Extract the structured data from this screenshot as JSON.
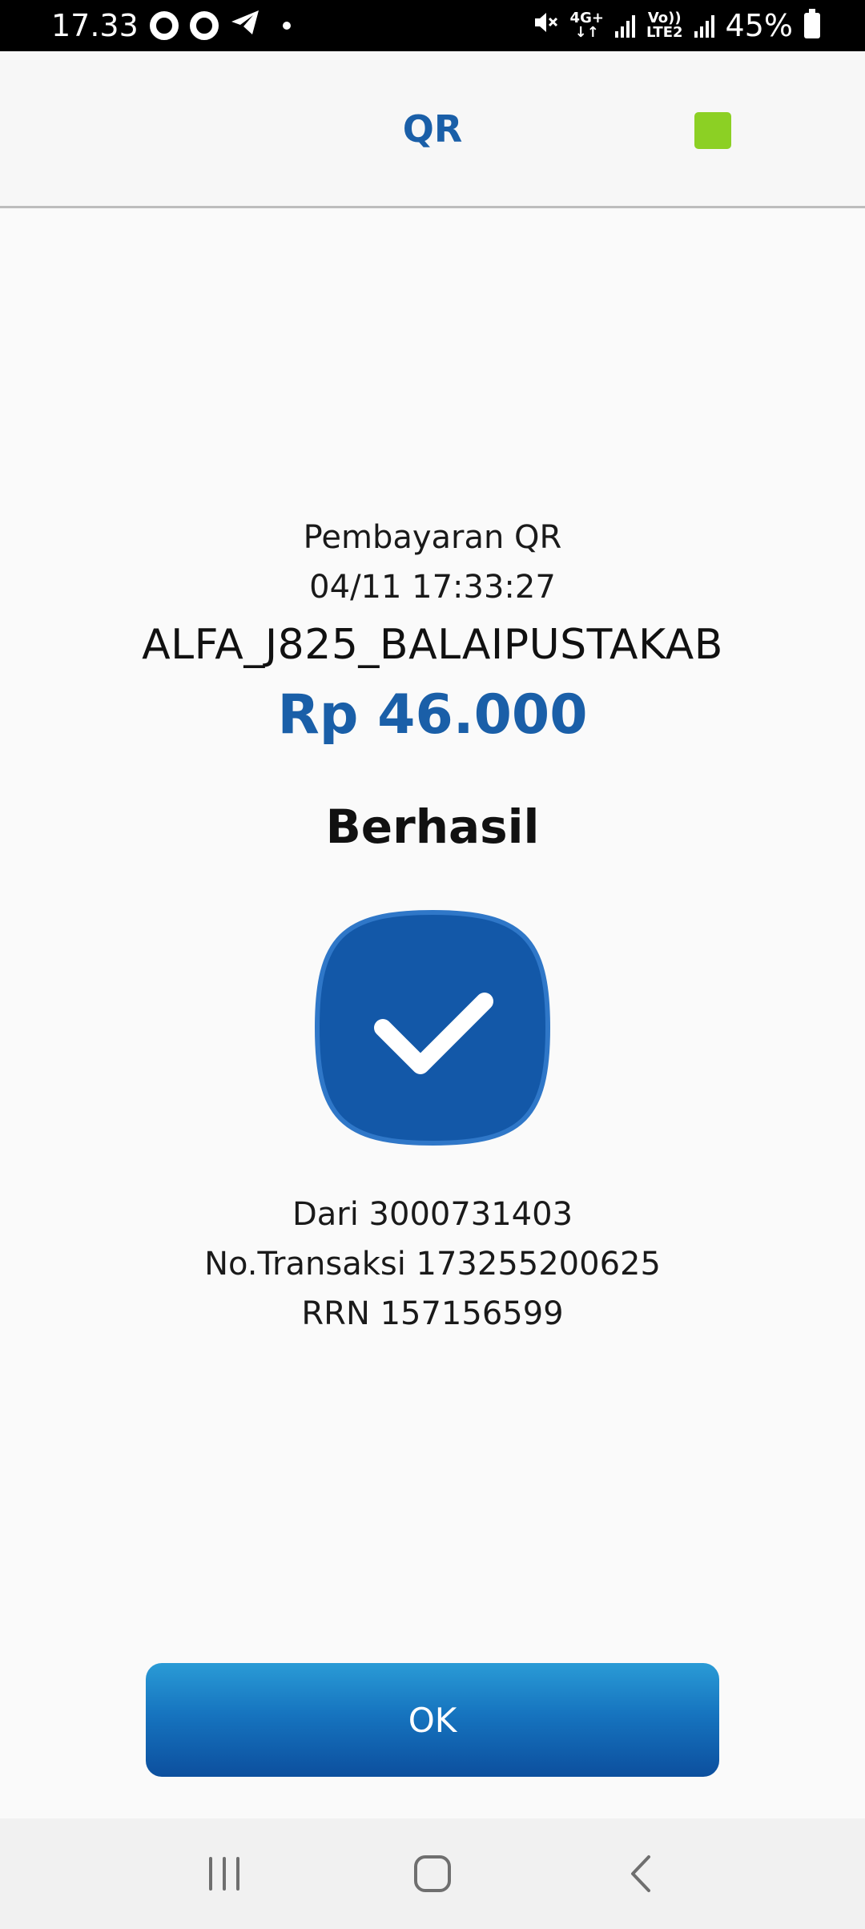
{
  "status_bar": {
    "time": "17.33",
    "network_type": "4G+",
    "volte_label": "Vo))",
    "lte_label": "LTE2",
    "battery": "45%"
  },
  "header": {
    "title": "QR"
  },
  "transaction": {
    "type": "Pembayaran QR",
    "datetime": "04/11 17:33:27",
    "merchant": "ALFA_J825_BALAIPUSTAKAB",
    "amount": "Rp 46.000",
    "status": "Berhasil",
    "from": "Dari 3000731403",
    "transaction_no": "No.Transaksi 173255200625",
    "rrn": "RRN 157156599"
  },
  "actions": {
    "ok_label": "OK"
  },
  "colors": {
    "accent": "#1a5fa8",
    "header_square": "#8cd024",
    "button_top": "#2a9bd6",
    "button_bottom": "#0c4f9e"
  },
  "icons": {
    "status_left": [
      "ring-icon",
      "ring-icon",
      "telegram-icon",
      "dot-icon"
    ],
    "status_right": [
      "mute-icon",
      "signal-icon",
      "signal-icon",
      "battery-icon"
    ],
    "badge": "checkmark-icon",
    "nav": [
      "recents-icon",
      "home-icon",
      "back-icon"
    ]
  }
}
